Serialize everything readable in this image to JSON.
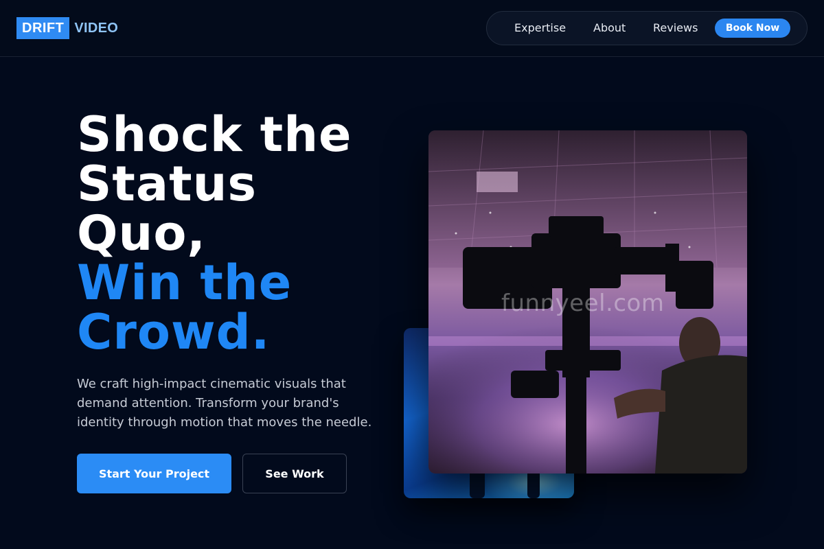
{
  "brand": {
    "logo_box_text": "DRIFT",
    "logo_text": "VIDEO"
  },
  "nav": {
    "links": [
      "Expertise",
      "About",
      "Reviews"
    ],
    "cta": "Book Now"
  },
  "hero": {
    "title_lines": [
      "Shock the",
      "Status",
      "Quo,"
    ],
    "accent_lines": [
      "Win the",
      "Crowd."
    ],
    "description": "We craft high-impact cinematic visuals that demand attention. Transform your brand's identity through motion that moves the needle.",
    "primary_button": "Start Your Project",
    "secondary_button": "See Work"
  },
  "visual": {
    "photo_icon": "camera-operator-photo",
    "back_card_icon": "concert-stage-photo",
    "watermark": "funnyeel.com"
  },
  "colors": {
    "background": "#020a1c",
    "accent": "#1f87f5",
    "button_blue": "#2b8cf5",
    "logo_blue": "#2f8bf3"
  }
}
